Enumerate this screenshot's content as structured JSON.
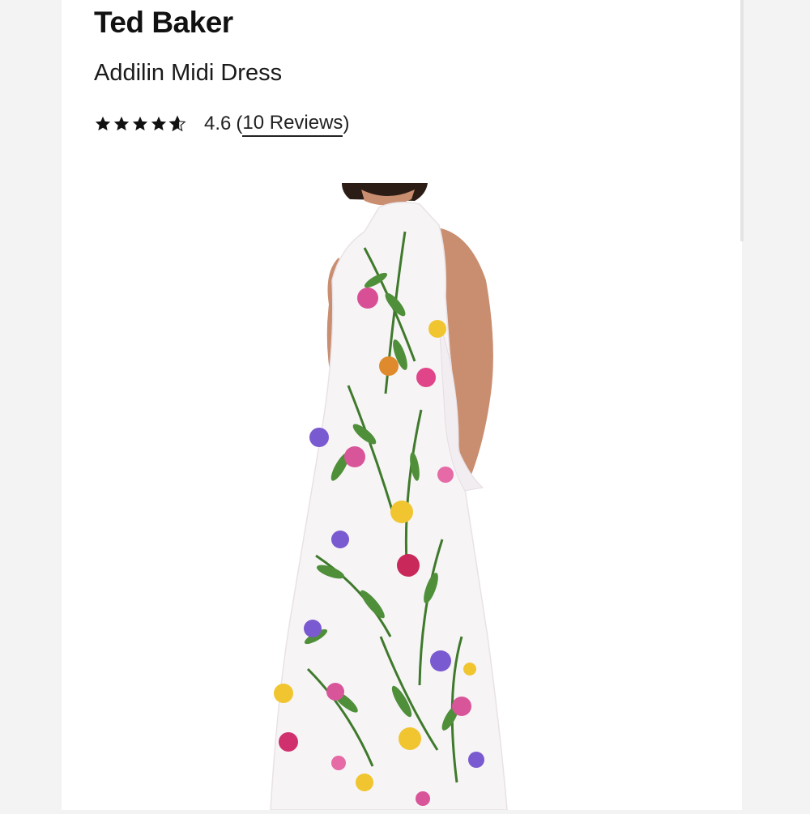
{
  "product": {
    "brand": "Ted Baker",
    "name": "Addilin Midi Dress",
    "rating": {
      "value": "4.6",
      "stars": 4.6,
      "max_stars": 5,
      "open_paren": "(",
      "reviews_label": "10 Reviews",
      "close_paren": ")"
    }
  },
  "image": {
    "alt": "Model wearing white floral print sleeveless midi dress"
  },
  "colors": {
    "background": "#f4f3f3",
    "card": "#ffffff",
    "text": "#111111",
    "dress": "#f7f4f6",
    "skin": "#c98d6f",
    "hair": "#2b1d16"
  }
}
